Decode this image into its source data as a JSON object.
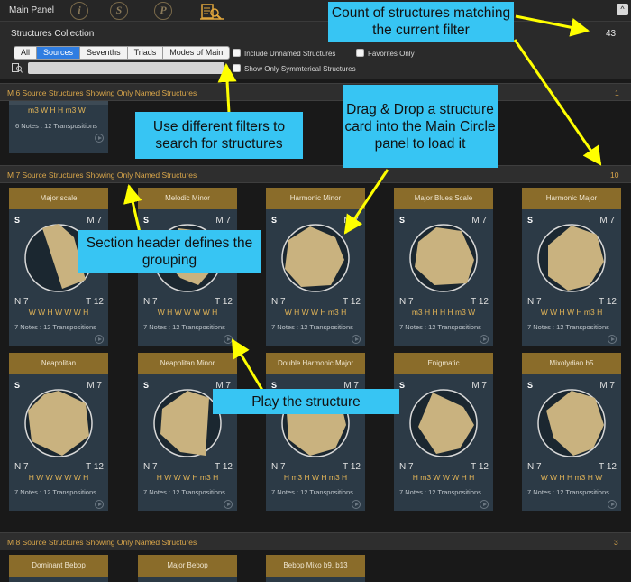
{
  "topbar": {
    "title": "Main Panel",
    "tool_icons": [
      "info-icon",
      "s-icon",
      "p-icon",
      "search-document-icon"
    ],
    "glyphs": {
      "info": "i",
      "s": "S",
      "p": "P"
    }
  },
  "collection": {
    "title": "Structures Collection",
    "count": "43",
    "tabs": [
      "All",
      "Sources",
      "Sevenths",
      "Triads",
      "Modes of Main"
    ],
    "active_tab": "Sources",
    "include_unnamed": "Include Unnamed Structures",
    "favorites_only": "Favorites Only",
    "symmetrical_only": "Show Only Symmterical Structures",
    "search_value": ""
  },
  "sections": [
    {
      "label": "M 6  Source Structures Showing Only Named Structures",
      "count": "1"
    },
    {
      "label": "M 7  Source Structures Showing Only Named Structures",
      "count": "10"
    },
    {
      "label": "M 8  Source Structures Showing Only Named Structures",
      "count": "3"
    }
  ],
  "partial_card": {
    "pattern": "m3 W H H m3 W",
    "notes": "6 Notes : 12 Transpositions"
  },
  "cards": [
    {
      "name": "Major scale",
      "s": "S",
      "m": "M 7",
      "n": "N 7",
      "t": "T 12",
      "pattern": "W W H W W W H",
      "notes": "7 Notes : 12 Transpositions"
    },
    {
      "name": "Melodic Minor",
      "s": "S",
      "m": "M 7",
      "n": "N 7",
      "t": "T 12",
      "pattern": "W H W W W W H",
      "notes": "7 Notes : 12 Transpositions"
    },
    {
      "name": "Harmonic Minor",
      "s": "S",
      "m": "M 7",
      "n": "N 7",
      "t": "T 12",
      "pattern": "W H W W H m3 H",
      "notes": "7 Notes : 12 Transpositions"
    },
    {
      "name": "Major Blues Scale",
      "s": "S",
      "m": "M 7",
      "n": "N 7",
      "t": "T 12",
      "pattern": "m3 H H H H m3 W",
      "notes": "7 Notes : 12 Transpositions"
    },
    {
      "name": "Harmonic Major",
      "s": "S",
      "m": "M 7",
      "n": "N 7",
      "t": "T 12",
      "pattern": "W W H W H m3 H",
      "notes": "7 Notes : 12 Transpositions"
    },
    {
      "name": "Neapolitan",
      "s": "S",
      "m": "M 7",
      "n": "N 7",
      "t": "T 12",
      "pattern": "H W W W W W H",
      "notes": "7 Notes : 12 Transpositions"
    },
    {
      "name": "Neapolitan Minor",
      "s": "S",
      "m": "M 7",
      "n": "N 7",
      "t": "T 12",
      "pattern": "H W W W H m3 H",
      "notes": "7 Notes : 12 Transpositions"
    },
    {
      "name": "Double Harmonic Major",
      "s": "S",
      "m": "M 7",
      "n": "N 7",
      "t": "T 12",
      "pattern": "H m3 H W H m3 H",
      "notes": "7 Notes : 12 Transpositions"
    },
    {
      "name": "Enigmatic",
      "s": "S",
      "m": "M 7",
      "n": "N 7",
      "t": "T 12",
      "pattern": "H m3 W W W H H",
      "notes": "7 Notes : 12 Transpositions"
    },
    {
      "name": "Mixolydian b5",
      "s": "S",
      "m": "M 7",
      "n": "N 7",
      "t": "T 12",
      "pattern": "W W H H m3 H W",
      "notes": "7 Notes : 12 Transpositions"
    }
  ],
  "bottom_cards": [
    "Dominant Bebop",
    "Major Bebop",
    "Bebop Mixo b9, b13"
  ],
  "callouts": {
    "count": "Count of structures matching the current filter",
    "filters": "Use different filters to search for structures",
    "drag": "Drag & Drop a structure card into the Main Circle panel to load it",
    "section": "Section header defines the grouping",
    "play": "Play the structure"
  },
  "colors": {
    "accent": "#d9a64a",
    "card_head": "#8a6c2a",
    "card_body": "#2c3a46",
    "callout": "#37c5f3",
    "arrow": "#ffff00",
    "polygon": "#c9b27f"
  }
}
